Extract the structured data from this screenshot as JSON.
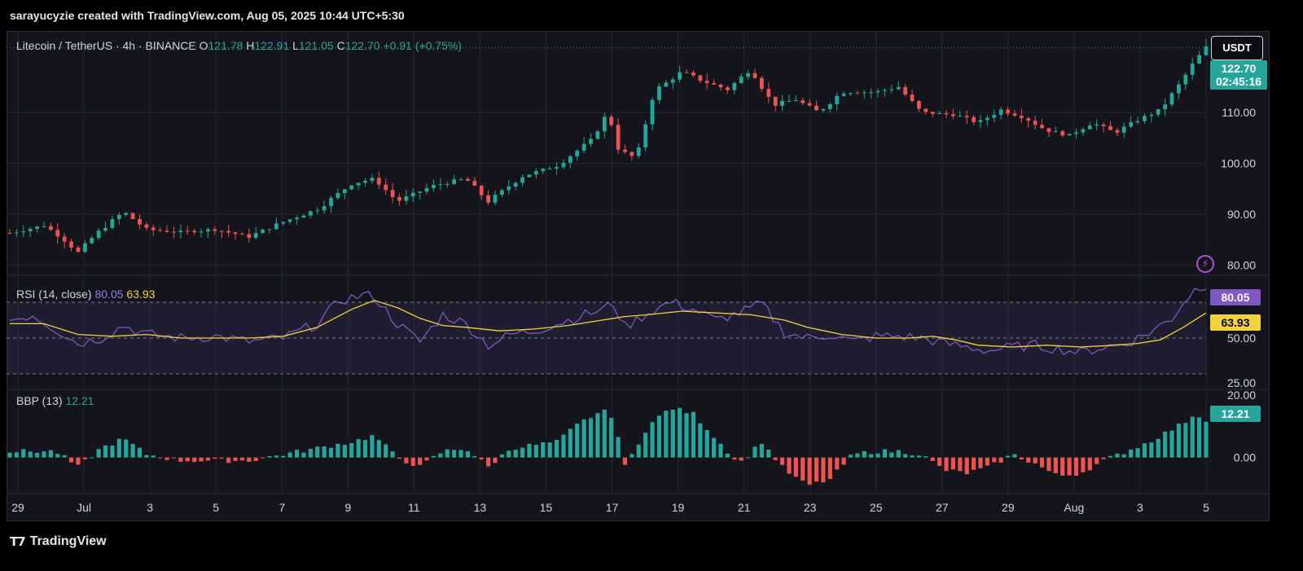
{
  "header": {
    "attribution": "sarayucyzie created with TradingView.com, Aug 05, 2025 10:44 UTC+5:30"
  },
  "legend": {
    "symbol": "Litecoin / TetherUS · 4h · BINANCE",
    "o_label": "O",
    "o_value": "121.78",
    "h_label": "H",
    "h_value": "122.91",
    "l_label": "L",
    "l_value": "121.05",
    "c_label": "C",
    "c_value": "122.70",
    "change": "+0.91 (+0.75%)"
  },
  "currency_button": "USDT",
  "price_tag": {
    "price": "122.70",
    "countdown": "02:45:16"
  },
  "rsi": {
    "label": "RSI (14, close)",
    "rsi_value": "80.05",
    "ma_value": "63.93"
  },
  "bbp": {
    "label": "BBP (13)",
    "value": "12.21"
  },
  "footer": {
    "brand": "TradingView"
  },
  "colors": {
    "up": "#26a69a",
    "down": "#ef5350",
    "rsi_line": "#7e57c2",
    "rsi_ma": "#f2d23d",
    "background": "#14151c",
    "grid": "#232631"
  },
  "chart_data": [
    {
      "type": "candlestick",
      "title": "Litecoin / TetherUS · 4h · BINANCE",
      "price_axis_ticks": [
        80,
        90,
        100,
        110,
        122.7
      ],
      "ylim": [
        78,
        126
      ],
      "x_ticks": [
        "29",
        "Jul",
        "3",
        "5",
        "7",
        "9",
        "11",
        "13",
        "15",
        "17",
        "19",
        "21",
        "23",
        "25",
        "27",
        "29",
        "Aug",
        "3",
        "5"
      ],
      "close_path": [
        {
          "t": 0,
          "c": 86.3
        },
        {
          "t": 6,
          "c": 87.8
        },
        {
          "t": 9,
          "c": 85.5
        },
        {
          "t": 12,
          "c": 82.5
        },
        {
          "t": 15,
          "c": 86.0
        },
        {
          "t": 20,
          "c": 90.5
        },
        {
          "t": 24,
          "c": 87.0
        },
        {
          "t": 30,
          "c": 86.5
        },
        {
          "t": 36,
          "c": 87.0
        },
        {
          "t": 42,
          "c": 85.6
        },
        {
          "t": 48,
          "c": 88.5
        },
        {
          "t": 54,
          "c": 91.0
        },
        {
          "t": 60,
          "c": 96.0
        },
        {
          "t": 64,
          "c": 97.0
        },
        {
          "t": 68,
          "c": 92.5
        },
        {
          "t": 74,
          "c": 95.5
        },
        {
          "t": 80,
          "c": 97.0
        },
        {
          "t": 84,
          "c": 92.5
        },
        {
          "t": 90,
          "c": 97.5
        },
        {
          "t": 96,
          "c": 99.5
        },
        {
          "t": 102,
          "c": 104.5
        },
        {
          "t": 105,
          "c": 110.0
        },
        {
          "t": 107,
          "c": 102.5
        },
        {
          "t": 110,
          "c": 101.0
        },
        {
          "t": 113,
          "c": 114.0
        },
        {
          "t": 118,
          "c": 118.0
        },
        {
          "t": 122,
          "c": 116.0
        },
        {
          "t": 126,
          "c": 114.5
        },
        {
          "t": 130,
          "c": 118.5
        },
        {
          "t": 134,
          "c": 111.5
        },
        {
          "t": 138,
          "c": 112.5
        },
        {
          "t": 142,
          "c": 110.0
        },
        {
          "t": 146,
          "c": 114.0
        },
        {
          "t": 152,
          "c": 114.0
        },
        {
          "t": 156,
          "c": 115.0
        },
        {
          "t": 160,
          "c": 110.0
        },
        {
          "t": 166,
          "c": 109.5
        },
        {
          "t": 170,
          "c": 108.0
        },
        {
          "t": 174,
          "c": 110.5
        },
        {
          "t": 178,
          "c": 109.0
        },
        {
          "t": 182,
          "c": 106.5
        },
        {
          "t": 186,
          "c": 105.5
        },
        {
          "t": 190,
          "c": 108.0
        },
        {
          "t": 194,
          "c": 106.0
        },
        {
          "t": 198,
          "c": 108.5
        },
        {
          "t": 202,
          "c": 110.5
        },
        {
          "t": 205,
          "c": 115.0
        },
        {
          "t": 208,
          "c": 120.0
        },
        {
          "t": 210,
          "c": 122.7
        }
      ]
    },
    {
      "type": "line",
      "title": "RSI (14, close)",
      "ylim": [
        25,
        80
      ],
      "levels": [
        70,
        50,
        30
      ],
      "axis_ticks": [
        25.0,
        50.0,
        75.0
      ],
      "series": [
        {
          "name": "RSI",
          "points": [
            [
              0,
              60
            ],
            [
              4,
              63
            ],
            [
              8,
              55
            ],
            [
              12,
              47
            ],
            [
              16,
              50
            ],
            [
              20,
              57
            ],
            [
              24,
              52
            ],
            [
              30,
              50
            ],
            [
              36,
              51
            ],
            [
              42,
              48
            ],
            [
              48,
              50
            ],
            [
              54,
              58
            ],
            [
              58,
              71
            ],
            [
              62,
              74
            ],
            [
              64,
              73
            ],
            [
              68,
              58
            ],
            [
              72,
              48
            ],
            [
              76,
              63
            ],
            [
              80,
              58
            ],
            [
              84,
              46
            ],
            [
              88,
              52
            ],
            [
              92,
              54
            ],
            [
              96,
              58
            ],
            [
              100,
              62
            ],
            [
              104,
              66
            ],
            [
              106,
              69
            ],
            [
              108,
              56
            ],
            [
              112,
              64
            ],
            [
              116,
              70
            ],
            [
              120,
              66
            ],
            [
              124,
              60
            ],
            [
              128,
              64
            ],
            [
              132,
              69
            ],
            [
              136,
              53
            ],
            [
              140,
              50
            ],
            [
              144,
              52
            ],
            [
              148,
              48
            ],
            [
              152,
              51
            ],
            [
              156,
              51
            ],
            [
              160,
              50
            ],
            [
              164,
              47
            ],
            [
              168,
              45
            ],
            [
              172,
              43
            ],
            [
              176,
              45
            ],
            [
              180,
              46
            ],
            [
              184,
              44
            ],
            [
              188,
              42
            ],
            [
              192,
              45
            ],
            [
              196,
              47
            ],
            [
              200,
              53
            ],
            [
              204,
              61
            ],
            [
              206,
              70
            ],
            [
              208,
              77
            ],
            [
              210,
              80
            ]
          ]
        },
        {
          "name": "RSI MA",
          "points": [
            [
              0,
              58
            ],
            [
              6,
              58
            ],
            [
              12,
              52
            ],
            [
              18,
              51
            ],
            [
              24,
              52
            ],
            [
              30,
              50
            ],
            [
              36,
              50
            ],
            [
              42,
              50
            ],
            [
              48,
              51
            ],
            [
              54,
              56
            ],
            [
              60,
              66
            ],
            [
              64,
              71
            ],
            [
              68,
              67
            ],
            [
              72,
              61
            ],
            [
              76,
              57
            ],
            [
              80,
              56
            ],
            [
              86,
              54
            ],
            [
              92,
              55
            ],
            [
              98,
              57
            ],
            [
              104,
              60
            ],
            [
              108,
              62
            ],
            [
              112,
              63
            ],
            [
              118,
              65
            ],
            [
              124,
              64
            ],
            [
              130,
              63
            ],
            [
              136,
              60
            ],
            [
              140,
              56
            ],
            [
              146,
              52
            ],
            [
              152,
              50
            ],
            [
              158,
              50
            ],
            [
              162,
              51
            ],
            [
              166,
              49
            ],
            [
              170,
              46
            ],
            [
              176,
              45
            ],
            [
              182,
              46
            ],
            [
              188,
              45
            ],
            [
              194,
              46
            ],
            [
              198,
              47
            ],
            [
              202,
              49
            ],
            [
              206,
              56
            ],
            [
              210,
              64
            ]
          ]
        }
      ]
    },
    {
      "type": "bar",
      "title": "BBP (13)",
      "ylim": [
        -10,
        20
      ],
      "axis_ticks": [
        0.0,
        20.0
      ],
      "series": [
        {
          "name": "BBP",
          "points": [
            [
              0,
              2
            ],
            [
              8,
              2
            ],
            [
              12,
              -3
            ],
            [
              16,
              3
            ],
            [
              20,
              6
            ],
            [
              24,
              1
            ],
            [
              30,
              -1
            ],
            [
              36,
              -1
            ],
            [
              42,
              -1
            ],
            [
              48,
              1
            ],
            [
              54,
              3
            ],
            [
              60,
              5
            ],
            [
              64,
              7
            ],
            [
              68,
              0
            ],
            [
              72,
              -3
            ],
            [
              76,
              2
            ],
            [
              80,
              3
            ],
            [
              84,
              -3
            ],
            [
              88,
              3
            ],
            [
              92,
              4
            ],
            [
              96,
              5
            ],
            [
              100,
              11
            ],
            [
              104,
              15
            ],
            [
              106,
              13
            ],
            [
              108,
              -3
            ],
            [
              112,
              10
            ],
            [
              116,
              16
            ],
            [
              120,
              14
            ],
            [
              124,
              6
            ],
            [
              128,
              -2
            ],
            [
              132,
              5
            ],
            [
              136,
              -4
            ],
            [
              140,
              -9
            ],
            [
              144,
              -7
            ],
            [
              148,
              1
            ],
            [
              152,
              2
            ],
            [
              156,
              2
            ],
            [
              160,
              1
            ],
            [
              164,
              -4
            ],
            [
              168,
              -5
            ],
            [
              172,
              -3
            ],
            [
              176,
              1
            ],
            [
              180,
              -2
            ],
            [
              184,
              -6
            ],
            [
              188,
              -5
            ],
            [
              192,
              -1
            ],
            [
              196,
              2
            ],
            [
              200,
              5
            ],
            [
              204,
              9
            ],
            [
              206,
              11
            ],
            [
              208,
              14
            ],
            [
              210,
              12.21
            ]
          ]
        }
      ]
    }
  ]
}
